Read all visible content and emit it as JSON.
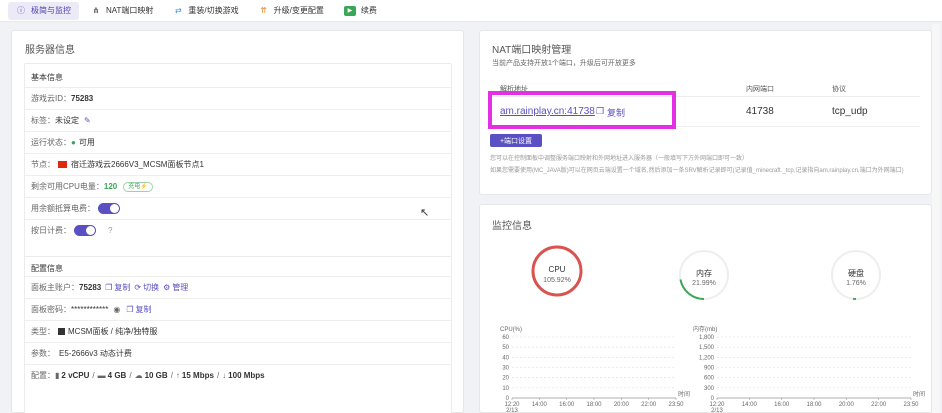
{
  "tabs": [
    {
      "label": "极简与监控",
      "icon": "info-icon",
      "active": true
    },
    {
      "label": "NAT端口映射",
      "icon": "network-icon",
      "active": false
    },
    {
      "label": "重装/切换游戏",
      "icon": "swap-icon",
      "active": false
    },
    {
      "label": "升级/变更配置",
      "icon": "upgrade-icon",
      "active": false
    },
    {
      "label": "续费",
      "icon": "renew-icon",
      "active": false
    }
  ],
  "server": {
    "title": "服务器信息",
    "basic": {
      "heading": "基本信息",
      "cloud_id_label": "游戏云ID：",
      "cloud_id": "75283",
      "tag_label": "标签：",
      "tag_value": "未设定",
      "status_label": "运行状态：",
      "status_value": "可用",
      "node_label": "节点：",
      "node_value": "宿迁游戏云2666V3_MCSM面板节点1",
      "cpu_label": "剩余可用CPU电量：",
      "cpu_value": "120",
      "cpu_badge": "充电",
      "overflow_label": "用余额抵算电费：",
      "hourly_label": "按日计费："
    },
    "config": {
      "heading": "配置信息",
      "panel_user_label": "面板主账户：",
      "panel_user": "75283",
      "copy_label": "复制",
      "switch_label": "切换",
      "manage_label": "管理",
      "panel_pwd_label": "面板密码：",
      "panel_pwd": "************",
      "type_label": "类型：",
      "type_value": "MCSM面板 / 纯净/独特服",
      "spec_label": "参数：",
      "spec_value": "E5-2666v3 动态计费",
      "resource_label": "配置：",
      "vcpu": "2 vCPU",
      "ram": "4 GB",
      "disk": "10 GB",
      "up": "15 Mbps",
      "down": "100 Mbps"
    }
  },
  "nat": {
    "title": "NAT端口映射管理",
    "desc": "当前产品支持开放1个端口，升级后可开放更多",
    "headers": [
      "解析地址",
      "内网端口",
      "协议"
    ],
    "address": "am.rainplay.cn:41738",
    "copy_label": "复制",
    "inner_port": "41738",
    "protocol": "tcp_udp",
    "add_button": "+端口设置",
    "hint1": "您可以在控制面板中调整服务端口映射和外网地址进入服务器（一般填写下方外网端口即可一致）",
    "hint2": "如果您需要使用(MC_JAVA版)可以在网页云端设置一个域名,然后添加一条SRV解析记录即可(记录值_minecraft._tcp,记录指向am.rainplay.cn,端口为外网端口)"
  },
  "monitor": {
    "title": "监控信息",
    "gauges": [
      {
        "label": "CPU",
        "value": "105.92%",
        "color": "#d9534f",
        "fraction": 1.0
      },
      {
        "label": "内存",
        "value": "21.99%",
        "color": "#3aa757",
        "fraction": 0.22
      },
      {
        "label": "硬盘",
        "value": "1.76%",
        "color": "#3aa757",
        "fraction": 0.02
      }
    ],
    "cpu_chart": {
      "ylabel": "CPU(%)",
      "xunit": "时间",
      "yticks": [
        "60",
        "50",
        "40",
        "30",
        "20",
        "10",
        "0"
      ],
      "xticks": [
        "12:20\n2/13",
        "14:00",
        "16:00",
        "18:00",
        "20:00",
        "22:00",
        "23:50"
      ]
    },
    "mem_chart": {
      "ylabel": "内存(mb)",
      "xunit": "时间",
      "yticks": [
        "1,800",
        "1,500",
        "1,200",
        "900",
        "600",
        "300",
        "0"
      ],
      "xticks": [
        "12:20\n2/13",
        "14:00",
        "16:00",
        "18:00",
        "20:00",
        "22:00",
        "23:50"
      ]
    }
  },
  "colors": {
    "accent": "#5a4fc3",
    "highlight": "#e52fe5"
  }
}
